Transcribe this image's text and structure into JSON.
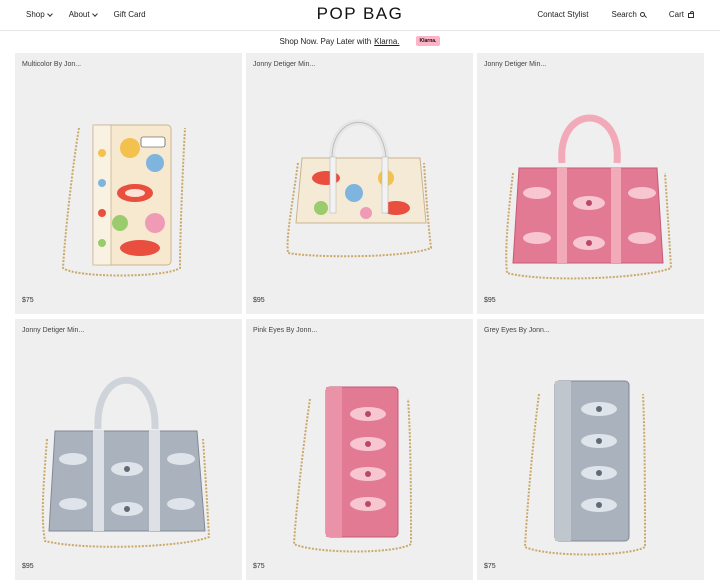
{
  "header": {
    "logo": "POP BAG",
    "nav_left": [
      {
        "label": "Shop"
      },
      {
        "label": "About"
      },
      {
        "label": "Gift Card"
      }
    ],
    "contact_label": "Contact Stylist",
    "search_label": "Search",
    "cart_label": "Cart"
  },
  "promo": {
    "text": "Shop Now. Pay Later with",
    "link": "Klarna.",
    "badge": "Klarna."
  },
  "products": [
    {
      "title": "Multicolor By Jon...",
      "price": "$75"
    },
    {
      "title": "Jonny Detiger Min...",
      "price": "$95"
    },
    {
      "title": "Jonny Detiger Min...",
      "price": "$95"
    },
    {
      "title": "Jonny Detiger Min...",
      "price": "$95"
    },
    {
      "title": "Pink Eyes By Jonn...",
      "price": "$75"
    },
    {
      "title": "Grey Eyes By Jonn...",
      "price": "$75"
    }
  ],
  "colors": {
    "card_bg": "#efefef",
    "multicolor": "#f2c14e",
    "pink": "#e27a93",
    "light_pink": "#f2aab8",
    "grey": "#a9b2bd",
    "gold_chain": "#caa96a",
    "klarna": "#ffb3c7"
  }
}
